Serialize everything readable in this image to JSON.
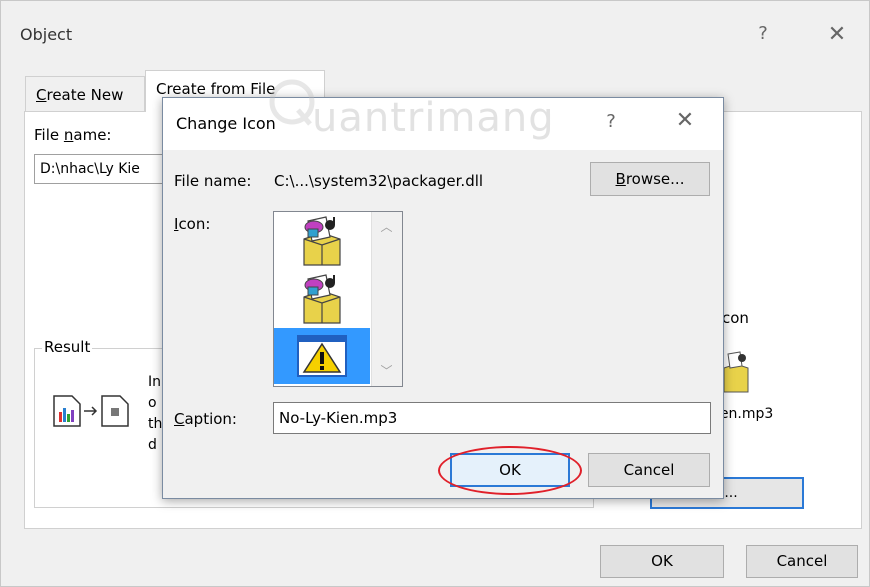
{
  "outer_dialog": {
    "title": "Object",
    "help_glyph": "?",
    "close_glyph": "✕",
    "tabs": [
      {
        "label_pre": "",
        "label_ul": "C",
        "label_post": "reate New"
      },
      {
        "label_pre": "Create from Fi",
        "label_ul": "",
        "label_post": "le"
      }
    ],
    "file_name_label_pre": "File ",
    "file_name_label_ul": "n",
    "file_name_label_post": "ame:",
    "file_name_value": "D:\\nhac\\Ly Kie",
    "result_label": "Result",
    "result_text_partial": "In o th d",
    "display_as_icon_label": "con",
    "icon_caption_partial": "ien.mp3",
    "change_icon_button_pre": "e ",
    "change_icon_button_ul": "I",
    "change_icon_button_post": "con...",
    "ok_label": "OK",
    "cancel_label": "Cancel"
  },
  "change_icon_dialog": {
    "title": "Change Icon",
    "help_glyph": "?",
    "close_glyph": "✕",
    "file_name_label": "File name:",
    "file_name_value": "C:\\...\\system32\\packager.dll",
    "browse_pre": "",
    "browse_ul": "B",
    "browse_post": "rowse...",
    "icon_label_ul": "I",
    "icon_label_post": "con:",
    "icons": [
      "package-icon",
      "package-icon",
      "warning-icon"
    ],
    "selected_icon_index": 2,
    "caption_label_ul": "C",
    "caption_label_post": "aption:",
    "caption_value": "No-Ly-Kien.mp3",
    "ok_label": "OK",
    "cancel_label": "Cancel"
  },
  "watermark": "uantrimang",
  "colors": {
    "dialog_bg": "#f0f0f0",
    "focus_border": "#2b79d6",
    "selection": "#3399ff",
    "highlight_ellipse": "#e0202a"
  }
}
